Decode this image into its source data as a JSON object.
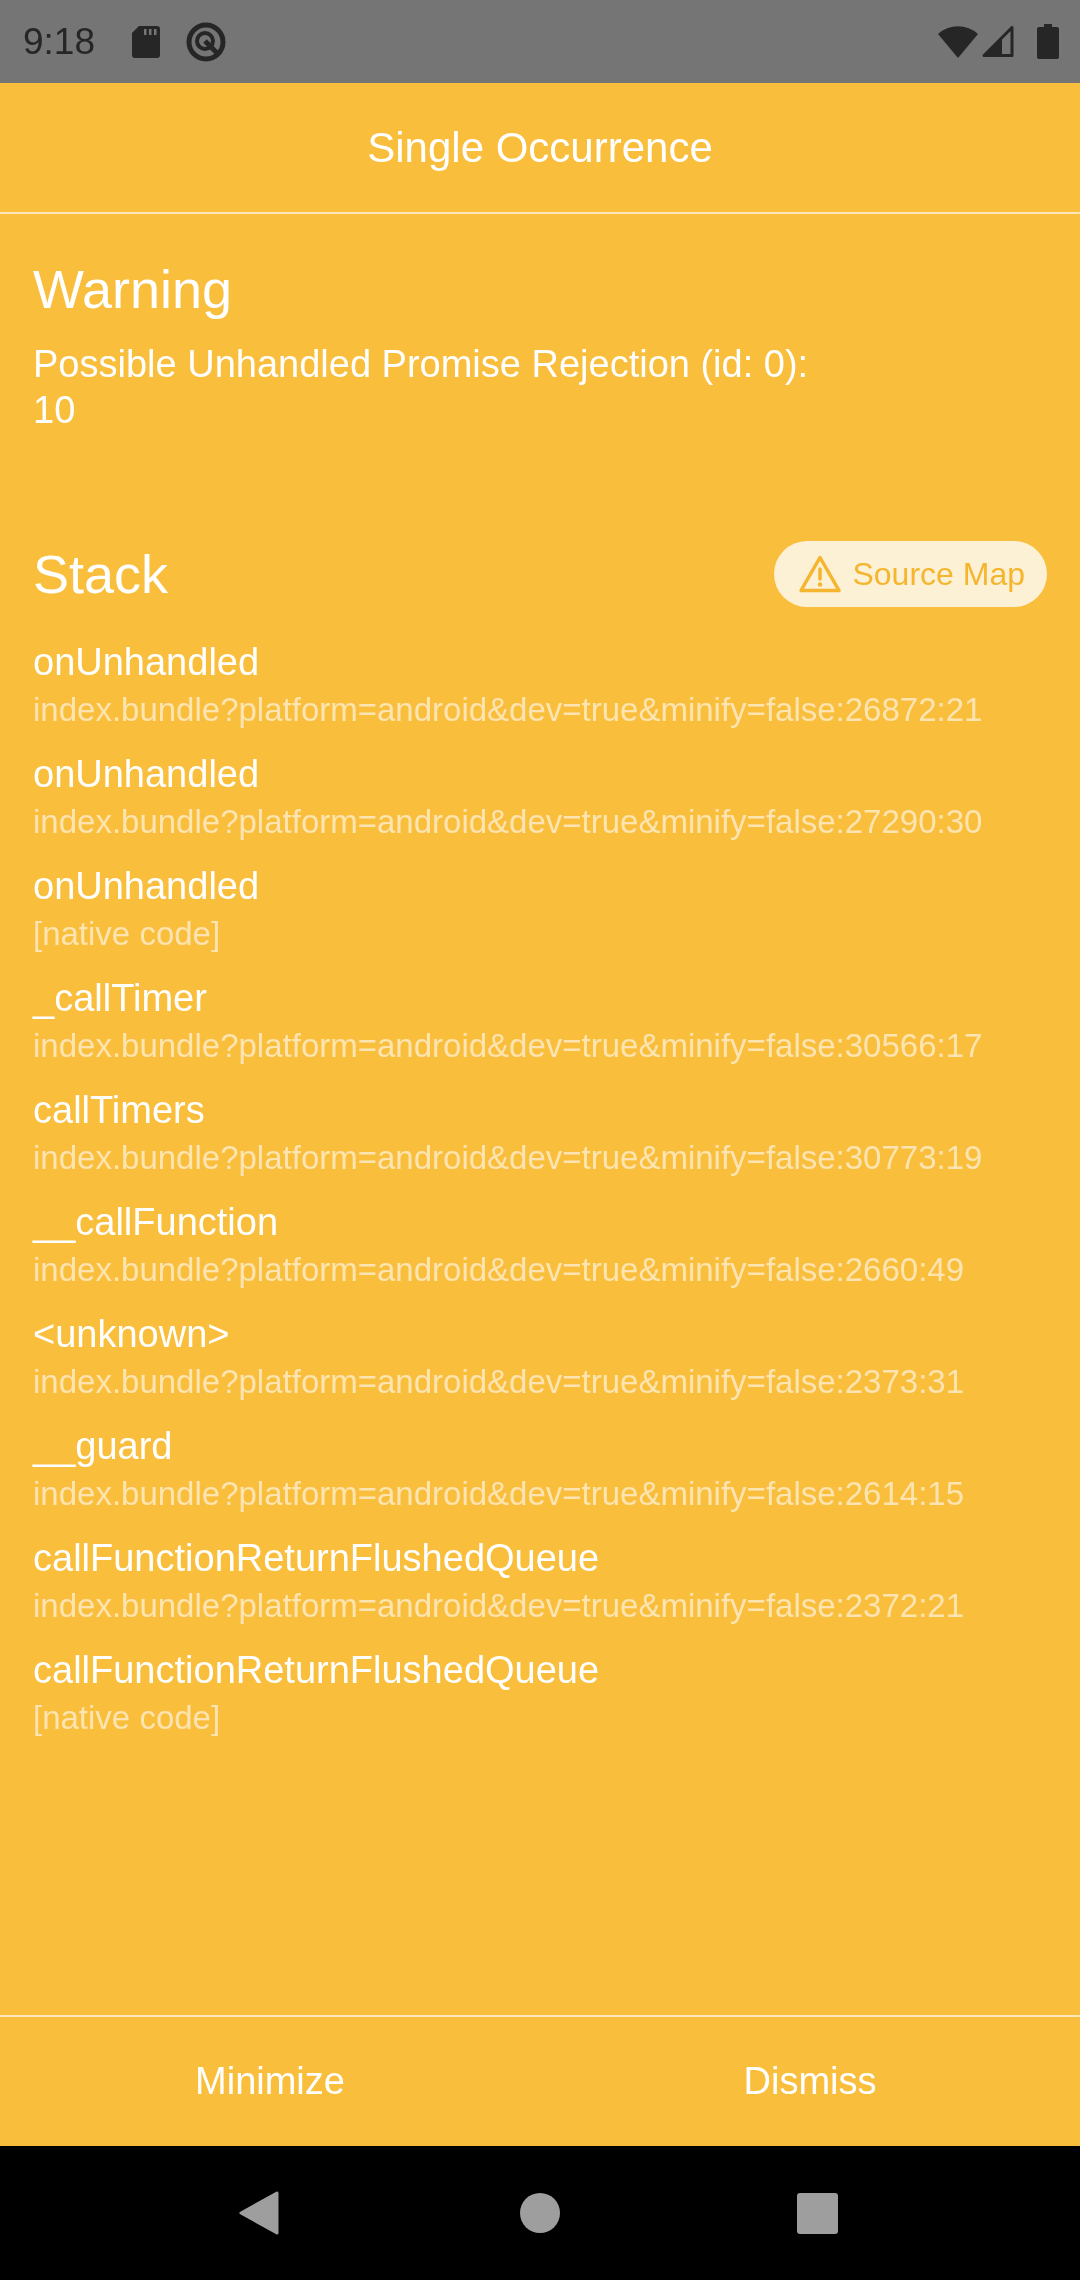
{
  "status_bar": {
    "time": "9:18"
  },
  "header": {
    "title": "Single Occurrence"
  },
  "warning": {
    "title": "Warning",
    "message": "Possible Unhandled Promise Rejection (id: 0):\n10"
  },
  "stack": {
    "title": "Stack",
    "source_map_button": "Source Map",
    "frames": [
      {
        "name": "onUnhandled",
        "location": "index.bundle?platform=android&dev=true&minify=false:26872:21"
      },
      {
        "name": "onUnhandled",
        "location": "index.bundle?platform=android&dev=true&minify=false:27290:30"
      },
      {
        "name": "onUnhandled",
        "location": "[native code]"
      },
      {
        "name": "_callTimer",
        "location": "index.bundle?platform=android&dev=true&minify=false:30566:17"
      },
      {
        "name": "callTimers",
        "location": "index.bundle?platform=android&dev=true&minify=false:30773:19"
      },
      {
        "name": "__callFunction",
        "location": "index.bundle?platform=android&dev=true&minify=false:2660:49"
      },
      {
        "name": "<unknown>",
        "location": "index.bundle?platform=android&dev=true&minify=false:2373:31"
      },
      {
        "name": "__guard",
        "location": "index.bundle?platform=android&dev=true&minify=false:2614:15"
      },
      {
        "name": "callFunctionReturnFlushedQueue",
        "location": "index.bundle?platform=android&dev=true&minify=false:2372:21"
      },
      {
        "name": "callFunctionReturnFlushedQueue",
        "location": "[native code]"
      }
    ]
  },
  "footer": {
    "buttons": [
      "Minimize",
      "Dismiss"
    ]
  }
}
